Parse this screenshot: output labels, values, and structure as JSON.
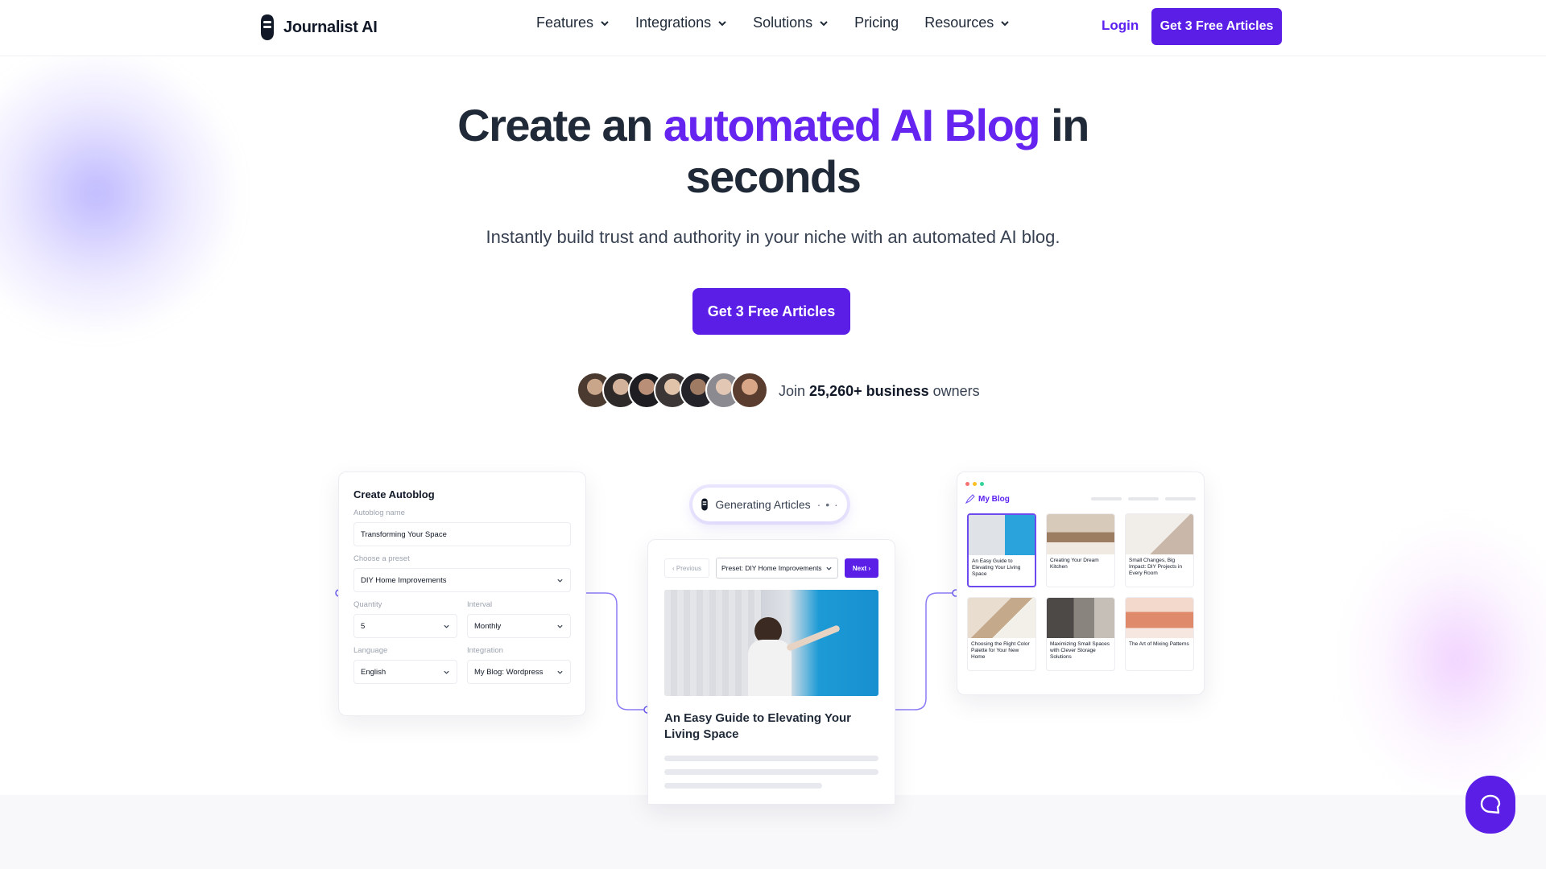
{
  "brand": {
    "name": "Journalist AI"
  },
  "nav": {
    "items": [
      {
        "label": "Features",
        "dropdown": true
      },
      {
        "label": "Integrations",
        "dropdown": true
      },
      {
        "label": "Solutions",
        "dropdown": true
      },
      {
        "label": "Pricing",
        "dropdown": false
      },
      {
        "label": "Resources",
        "dropdown": true
      }
    ],
    "login": "Login",
    "cta": "Get 3 Free Articles"
  },
  "hero": {
    "title_before": "Create an ",
    "title_accent": "automated AI Blog",
    "title_after": " in seconds",
    "subtitle": "Instantly build trust and authority in your niche with an automated AI blog.",
    "cta": "Get 3 Free Articles",
    "join_prefix": "Join ",
    "join_count": "25,260+ business",
    "join_suffix": " owners"
  },
  "autoblog": {
    "title": "Create Autoblog",
    "name_label": "Autoblog name",
    "name_value": "Transforming Your Space",
    "preset_label": "Choose a preset",
    "preset_value": "DIY Home Improvements",
    "quantity_label": "Quantity",
    "quantity_value": "5",
    "interval_label": "Interval",
    "interval_value": "Monthly",
    "language_label": "Language",
    "language_value": "English",
    "integration_label": "Integration",
    "integration_value": "My Blog: Wordpress"
  },
  "generating": {
    "label": "Generating Articles"
  },
  "article": {
    "prev": "Previous",
    "preset": "Preset: DIY Home Improvements",
    "next": "Next",
    "title": "An Easy Guide to Elevating Your Living Space"
  },
  "myblog": {
    "title": "My Blog",
    "tiles": [
      {
        "caption": "An Easy Guide to Elevating Your Living Space",
        "color": "#2aa3dc",
        "selected": true
      },
      {
        "caption": "Creating Your Dream Kitchen",
        "color": "#b9a48d",
        "selected": false
      },
      {
        "caption": "Small Changes, Big Impact: DIY Projects in Every Room",
        "color": "#e7e3de",
        "selected": false
      },
      {
        "caption": "Choosing the Right Color Palette for Your New Home",
        "color": "#d8c8b4",
        "selected": false
      },
      {
        "caption": "Maximizing Small Spaces with Clever Storage Solutions",
        "color": "#6f6a66",
        "selected": false
      },
      {
        "caption": "The Art of Mixing Patterns",
        "color": "#e59a80",
        "selected": false
      }
    ]
  },
  "colors": {
    "accent": "#5b1ee6",
    "accent_text": "#6524ef"
  }
}
